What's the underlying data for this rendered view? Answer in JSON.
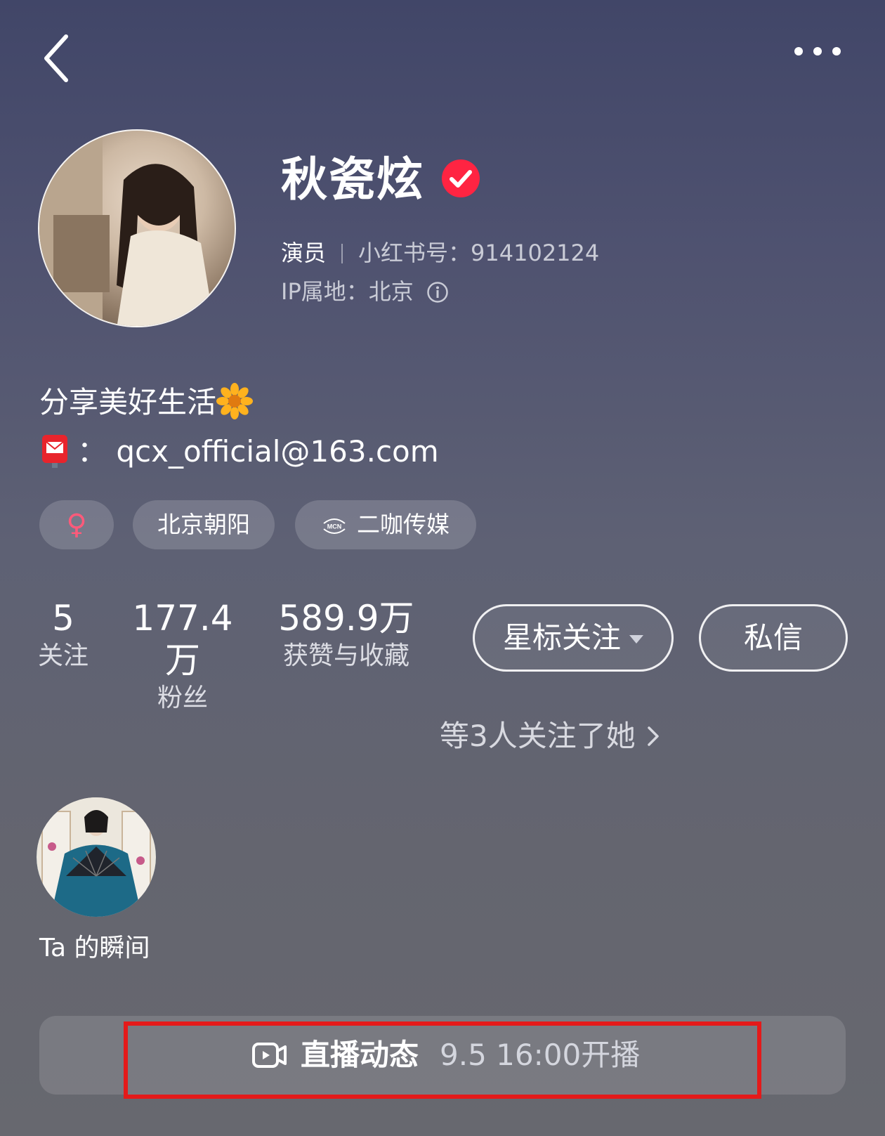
{
  "header": {
    "back_icon": "chevron-left-icon",
    "more_icon": "ellipsis-icon"
  },
  "profile": {
    "name": "秋瓷炫",
    "verified_color": "#ff2442",
    "role": "演员",
    "red_id": "小红书号：914102124",
    "ip_location": "IP属地：北京"
  },
  "bio": {
    "line1": "分享美好生活",
    "line2": "：  qcx_official@163.com"
  },
  "tags": {
    "gender": "♀",
    "location": "北京朝阳",
    "mcn_icon_text": "MCN",
    "mcn": "二咖传媒"
  },
  "stats": [
    {
      "value": "5",
      "label": "关注"
    },
    {
      "value": "177.4万",
      "label": "粉丝"
    },
    {
      "value": "589.9万",
      "label": "获赞与收藏"
    }
  ],
  "actions": {
    "follow_label": "星标关注",
    "message_label": "私信"
  },
  "followed_by": "等3人关注了她",
  "moments": {
    "label": "Ta 的瞬间"
  },
  "live": {
    "title": "直播动态",
    "schedule": "9.5 16:00开播",
    "highlight_color": "#e41a1a"
  },
  "colors": {
    "gender_icon": "#ff5a7a"
  }
}
